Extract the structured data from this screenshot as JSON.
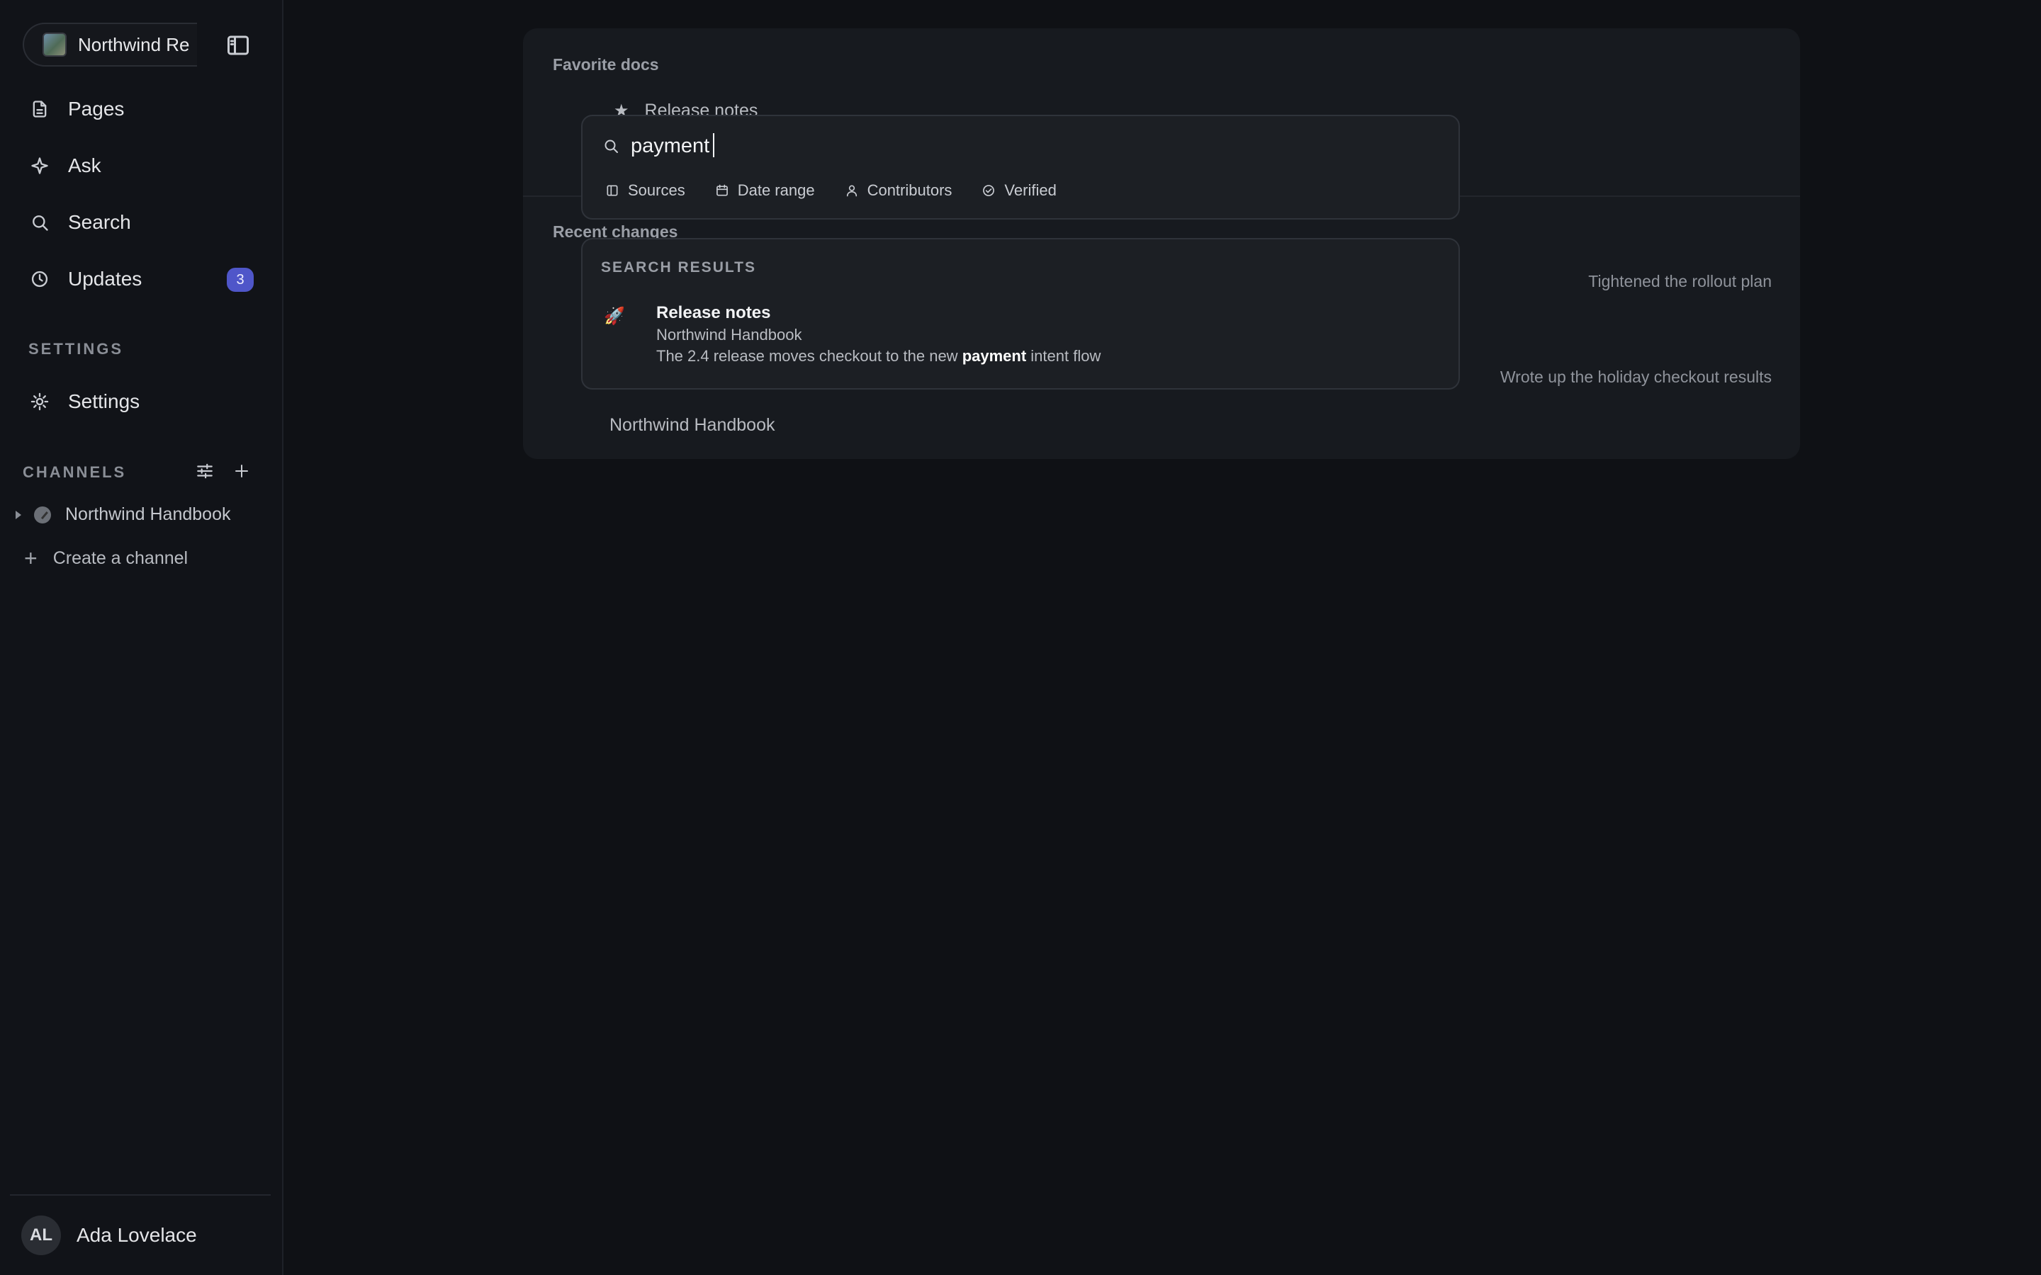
{
  "sidebar": {
    "workspace_name": "Northwind Re",
    "nav": [
      {
        "label": "Pages",
        "icon": "document-icon"
      },
      {
        "label": "Ask",
        "icon": "sparkle-icon"
      },
      {
        "label": "Search",
        "icon": "search-icon"
      },
      {
        "label": "Updates",
        "icon": "clock-icon",
        "badge": "3"
      }
    ],
    "settings_section": "SETTINGS",
    "settings_label": "Settings",
    "channels_section": "CHANNELS",
    "channels": [
      {
        "label": "Northwind Handbook"
      }
    ],
    "create_channel": "Create a channel",
    "user": {
      "initials": "AL",
      "name": "Ada Lovelace"
    }
  },
  "main": {
    "favorite_docs_title": "Favorite docs",
    "favorites": [
      {
        "label": "Release notes"
      }
    ],
    "recent_changes_title": "Recent changes",
    "changes": [
      {
        "note": "Tightened the rollout plan"
      },
      {
        "note": "Wrote up the holiday checkout results"
      }
    ],
    "footer_channel": "Northwind Handbook"
  },
  "search": {
    "query": "payment",
    "filters": [
      {
        "label": "Sources",
        "icon": "panel-icon"
      },
      {
        "label": "Date range",
        "icon": "calendar-icon"
      },
      {
        "label": "Contributors",
        "icon": "person-icon"
      },
      {
        "label": "Verified",
        "icon": "check-circle-icon"
      }
    ],
    "results_heading": "SEARCH RESULTS",
    "results": [
      {
        "emoji": "🚀",
        "title": "Release notes",
        "source": "Northwind Handbook",
        "snippet_before": "The 2.4 release moves checkout to the new ",
        "snippet_match": "payment",
        "snippet_after": " intent flow"
      }
    ]
  },
  "colors": {
    "background": "#0f1115",
    "accent": "#4f56c9"
  }
}
